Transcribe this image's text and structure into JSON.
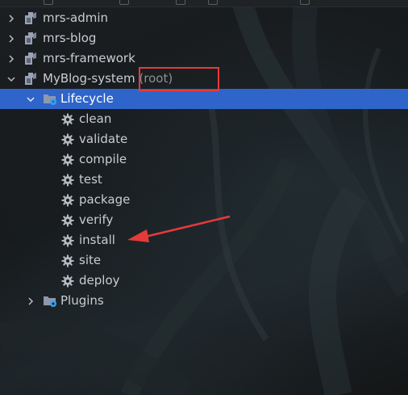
{
  "project_tree": {
    "modules": [
      {
        "name": "mrs-admin",
        "expanded": false
      },
      {
        "name": "mrs-blog",
        "expanded": false
      },
      {
        "name": "mrs-framework",
        "expanded": false
      },
      {
        "name": "MyBlog-system",
        "suffix": "(root)",
        "expanded": true
      }
    ],
    "lifecycle": {
      "label": "Lifecycle",
      "expanded": true,
      "selected": true,
      "goals": [
        "clean",
        "validate",
        "compile",
        "test",
        "package",
        "verify",
        "install",
        "site",
        "deploy"
      ]
    },
    "plugins": {
      "label": "Plugins",
      "expanded": false
    }
  },
  "annotations": {
    "highlight_color": "#e63a3a",
    "boxed_item": "MyBlog-system (root)",
    "arrow_target": "install"
  },
  "colors": {
    "selection": "#2f65ca",
    "text": "#c9ccd1",
    "maven_icon": "#9aa3b5",
    "folder_icon": "#8e99ad",
    "folder_badge": "#3aa0e8",
    "gear_icon": "#b4b8bf"
  }
}
